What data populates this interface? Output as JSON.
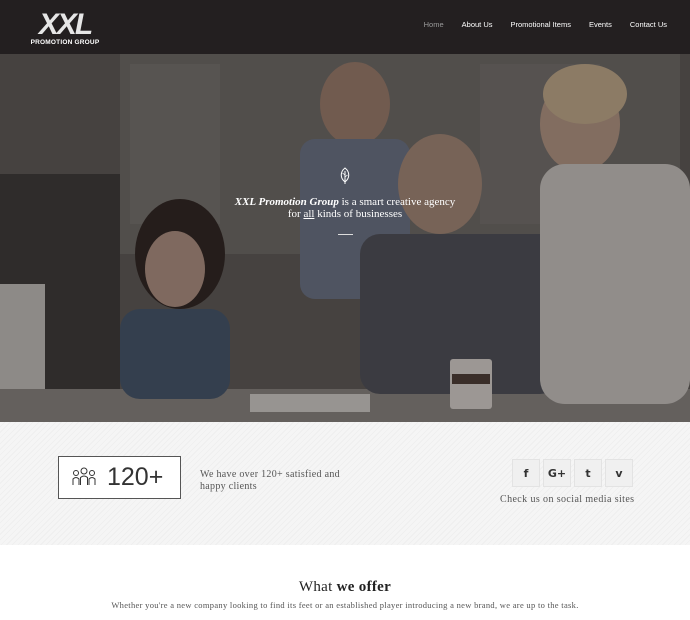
{
  "header": {
    "logo_main": "XXL",
    "logo_sub": "PROMOTION GROUP",
    "nav": [
      {
        "label": "Home",
        "active": true
      },
      {
        "label": "About Us",
        "active": false
      },
      {
        "label": "Promotional Items",
        "active": false
      },
      {
        "label": "Events",
        "active": false
      },
      {
        "label": "Contact Us",
        "active": false
      }
    ]
  },
  "hero": {
    "brand": "XXL Promotion Group",
    "line1_rest": " is a smart creative agency",
    "line2_pre": "for ",
    "line2_emph": "all",
    "line2_post": " kinds of businesses",
    "icon": "leaf-icon"
  },
  "stats": {
    "count": "120+",
    "text": "We have over 120+ satisfied and happy clients",
    "icon": "people-icon"
  },
  "social": {
    "items": [
      {
        "name": "facebook-icon",
        "glyph": "f"
      },
      {
        "name": "google-plus-icon",
        "glyph": "G+"
      },
      {
        "name": "twitter-icon",
        "glyph": "t"
      },
      {
        "name": "vimeo-icon",
        "glyph": "v"
      }
    ],
    "caption": "Check us on social media sites"
  },
  "offer": {
    "title_pre": "What ",
    "title_bold": "we offer",
    "subtitle": "Whether you're a new company looking to find its feet or an established player introducing a new brand, we are up to the task."
  },
  "colors": {
    "header_bg": "#231f20",
    "nav_active": "#9a9a9a",
    "band_bg": "#f5f5f5"
  }
}
